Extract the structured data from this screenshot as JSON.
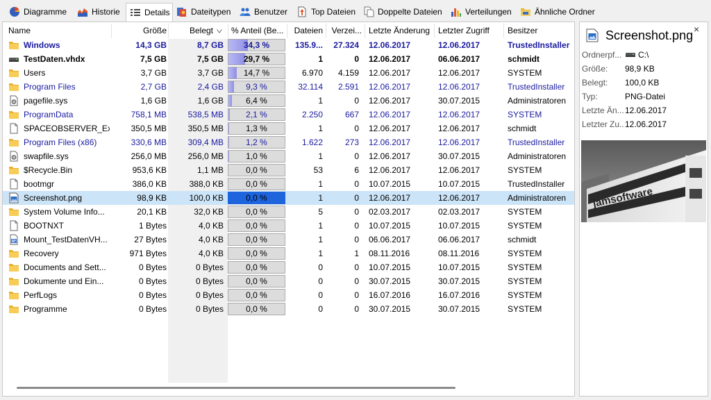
{
  "tabs": [
    {
      "label": "Diagramme",
      "icon": "pie-chart-icon"
    },
    {
      "label": "Historie",
      "icon": "history-chart-icon"
    },
    {
      "label": "Details",
      "icon": "details-list-icon"
    },
    {
      "label": "Dateitypen",
      "icon": "filetypes-icon"
    },
    {
      "label": "Benutzer",
      "icon": "users-icon"
    },
    {
      "label": "Top Dateien",
      "icon": "top-files-icon"
    },
    {
      "label": "Doppelte Dateien",
      "icon": "duplicate-files-icon"
    },
    {
      "label": "Verteilungen",
      "icon": "distribution-chart-icon"
    },
    {
      "label": "Ähnliche Ordner",
      "icon": "similar-folders-icon"
    }
  ],
  "active_tab": "Details",
  "columns": [
    "Name",
    "Größe",
    "Belegt",
    "% Anteil (Be...",
    "Dateien",
    "Verzei...",
    "Letzte Änderung",
    "Letzter Zugriff",
    "Besitzer"
  ],
  "sort_column": "Belegt",
  "rows": [
    {
      "name": "Windows",
      "size": "14,3 GB",
      "alloc": "8,7 GB",
      "pct": "34,3 %",
      "pct_value": 34.3,
      "files": "135.9...",
      "folders": "27.324",
      "modified": "12.06.2017",
      "accessed": "12.06.2017",
      "owner": "TrustedInstaller",
      "icon": "folder-icon",
      "style": "bold-blue"
    },
    {
      "name": "TestDaten.vhdx",
      "size": "7,5 GB",
      "alloc": "7,5 GB",
      "pct": "29,7 %",
      "pct_value": 29.7,
      "files": "1",
      "folders": "0",
      "modified": "12.06.2017",
      "accessed": "06.06.2017",
      "owner": "schmidt",
      "icon": "drive-icon",
      "style": "bold"
    },
    {
      "name": "Users",
      "size": "3,7 GB",
      "alloc": "3,7 GB",
      "pct": "14,7 %",
      "pct_value": 14.7,
      "files": "6.970",
      "folders": "4.159",
      "modified": "12.06.2017",
      "accessed": "12.06.2017",
      "owner": "SYSTEM",
      "icon": "folder-icon",
      "style": "normal"
    },
    {
      "name": "Program Files",
      "size": "2,7 GB",
      "alloc": "2,4 GB",
      "pct": "9,3 %",
      "pct_value": 9.3,
      "files": "32.114",
      "folders": "2.591",
      "modified": "12.06.2017",
      "accessed": "12.06.2017",
      "owner": "TrustedInstaller",
      "icon": "folder-icon",
      "style": "blue"
    },
    {
      "name": "pagefile.sys",
      "size": "1,6 GB",
      "alloc": "1,6 GB",
      "pct": "6,4 %",
      "pct_value": 6.4,
      "files": "1",
      "folders": "0",
      "modified": "12.06.2017",
      "accessed": "30.07.2015",
      "owner": "Administratoren",
      "icon": "system-file-icon",
      "style": "normal"
    },
    {
      "name": "ProgramData",
      "size": "758,1 MB",
      "alloc": "538,5 MB",
      "pct": "2,1 %",
      "pct_value": 2.1,
      "files": "2.250",
      "folders": "667",
      "modified": "12.06.2017",
      "accessed": "12.06.2017",
      "owner": "SYSTEM",
      "icon": "folder-icon",
      "style": "blue"
    },
    {
      "name": "SPACEOBSERVER_Ex...",
      "size": "350,5 MB",
      "alloc": "350,5 MB",
      "pct": "1,3 %",
      "pct_value": 1.3,
      "files": "1",
      "folders": "0",
      "modified": "12.06.2017",
      "accessed": "12.06.2017",
      "owner": "schmidt",
      "icon": "file-icon",
      "style": "normal"
    },
    {
      "name": "Program Files (x86)",
      "size": "330,6 MB",
      "alloc": "309,4 MB",
      "pct": "1,2 %",
      "pct_value": 1.2,
      "files": "1.622",
      "folders": "273",
      "modified": "12.06.2017",
      "accessed": "12.06.2017",
      "owner": "TrustedInstaller",
      "icon": "folder-icon",
      "style": "blue"
    },
    {
      "name": "swapfile.sys",
      "size": "256,0 MB",
      "alloc": "256,0 MB",
      "pct": "1,0 %",
      "pct_value": 1.0,
      "files": "1",
      "folders": "0",
      "modified": "12.06.2017",
      "accessed": "30.07.2015",
      "owner": "Administratoren",
      "icon": "system-file-icon",
      "style": "normal"
    },
    {
      "name": "$Recycle.Bin",
      "size": "953,6 KB",
      "alloc": "1,1 MB",
      "pct": "0,0 %",
      "pct_value": 0.0,
      "files": "53",
      "folders": "6",
      "modified": "12.06.2017",
      "accessed": "12.06.2017",
      "owner": "SYSTEM",
      "icon": "folder-icon",
      "style": "normal"
    },
    {
      "name": "bootmgr",
      "size": "386,0 KB",
      "alloc": "388,0 KB",
      "pct": "0,0 %",
      "pct_value": 0.0,
      "files": "1",
      "folders": "0",
      "modified": "10.07.2015",
      "accessed": "10.07.2015",
      "owner": "TrustedInstaller",
      "icon": "file-icon",
      "style": "normal"
    },
    {
      "name": "Screenshot.png",
      "size": "98,9 KB",
      "alloc": "100,0 KB",
      "pct": "0,0 %",
      "pct_value": 0.0,
      "files": "1",
      "folders": "0",
      "modified": "12.06.2017",
      "accessed": "12.06.2017",
      "owner": "Administratoren",
      "icon": "image-file-icon",
      "style": "selected"
    },
    {
      "name": "System Volume Info...",
      "size": "20,1 KB",
      "alloc": "32,0 KB",
      "pct": "0,0 %",
      "pct_value": 0.0,
      "files": "5",
      "folders": "0",
      "modified": "02.03.2017",
      "accessed": "02.03.2017",
      "owner": "SYSTEM",
      "icon": "folder-icon",
      "style": "normal"
    },
    {
      "name": "BOOTNXT",
      "size": "1 Bytes",
      "alloc": "4,0 KB",
      "pct": "0,0 %",
      "pct_value": 0.0,
      "files": "1",
      "folders": "0",
      "modified": "10.07.2015",
      "accessed": "10.07.2015",
      "owner": "SYSTEM",
      "icon": "file-icon",
      "style": "normal"
    },
    {
      "name": "Mount_TestDatenVH...",
      "size": "27 Bytes",
      "alloc": "4,0 KB",
      "pct": "0,0 %",
      "pct_value": 0.0,
      "files": "1",
      "folders": "0",
      "modified": "06.06.2017",
      "accessed": "06.06.2017",
      "owner": "schmidt",
      "icon": "script-file-icon",
      "style": "normal"
    },
    {
      "name": "Recovery",
      "size": "971 Bytes",
      "alloc": "4,0 KB",
      "pct": "0,0 %",
      "pct_value": 0.0,
      "files": "1",
      "folders": "1",
      "modified": "08.11.2016",
      "accessed": "08.11.2016",
      "owner": "SYSTEM",
      "icon": "folder-icon",
      "style": "normal"
    },
    {
      "name": "Documents and Sett...",
      "size": "0 Bytes",
      "alloc": "0 Bytes",
      "pct": "0,0 %",
      "pct_value": 0.0,
      "files": "0",
      "folders": "0",
      "modified": "10.07.2015",
      "accessed": "10.07.2015",
      "owner": "SYSTEM",
      "icon": "folder-icon",
      "style": "normal"
    },
    {
      "name": "Dokumente und Ein...",
      "size": "0 Bytes",
      "alloc": "0 Bytes",
      "pct": "0,0 %",
      "pct_value": 0.0,
      "files": "0",
      "folders": "0",
      "modified": "30.07.2015",
      "accessed": "30.07.2015",
      "owner": "SYSTEM",
      "icon": "folder-icon",
      "style": "normal"
    },
    {
      "name": "PerfLogs",
      "size": "0 Bytes",
      "alloc": "0 Bytes",
      "pct": "0,0 %",
      "pct_value": 0.0,
      "files": "0",
      "folders": "0",
      "modified": "16.07.2016",
      "accessed": "16.07.2016",
      "owner": "SYSTEM",
      "icon": "folder-icon",
      "style": "normal"
    },
    {
      "name": "Programme",
      "size": "0 Bytes",
      "alloc": "0 Bytes",
      "pct": "0,0 %",
      "pct_value": 0.0,
      "files": "0",
      "folders": "0",
      "modified": "30.07.2015",
      "accessed": "30.07.2015",
      "owner": "SYSTEM",
      "icon": "folder-icon",
      "style": "normal"
    }
  ],
  "details_panel": {
    "title": "Screenshot.png",
    "close_symbol": "×",
    "properties": [
      {
        "label": "Ordnerpf...",
        "value": "C:\\"
      },
      {
        "label": "Größe:",
        "value": "98,9 KB"
      },
      {
        "label": "Belegt:",
        "value": "100,0 KB"
      },
      {
        "label": "Typ:",
        "value": "PNG-Datei"
      },
      {
        "label": "Letzte Än...",
        "value": "12.06.2017"
      },
      {
        "label": "Letzter Zu...",
        "value": "12.06.2017"
      }
    ],
    "preview_text": "jamsoftware"
  },
  "colors": {
    "blue_text": "#1a1aa0",
    "selection": "#cce4f7",
    "bar_fill": "#9b9be9",
    "selected_bar": "#1e64dc",
    "folder": "#f5c342"
  }
}
